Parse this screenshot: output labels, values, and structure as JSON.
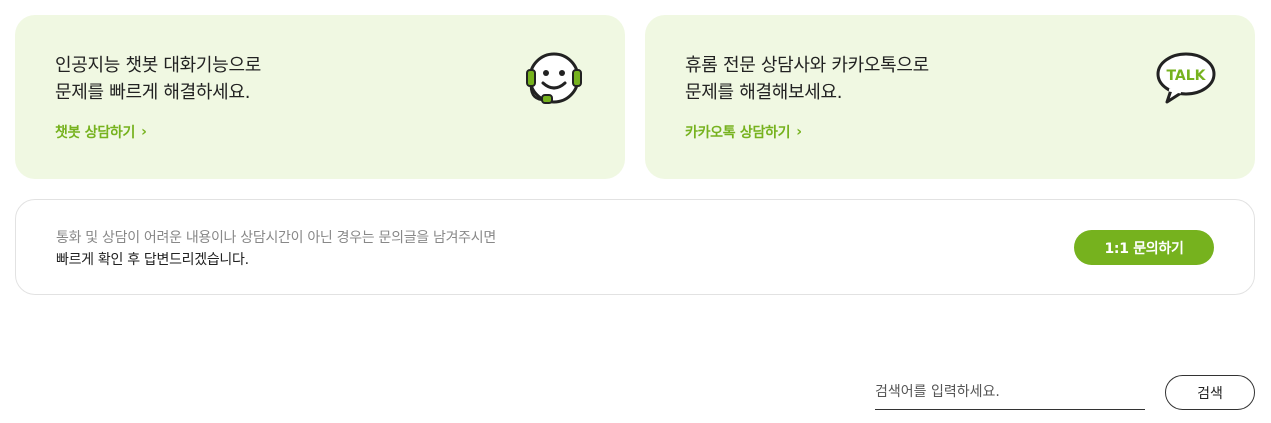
{
  "colors": {
    "accent": "#76b21e",
    "card_bg": "#f0f8e2"
  },
  "chatbot_card": {
    "line1": "인공지능 챗봇 대화기능으로",
    "line2": "문제를 빠르게 해결하세요.",
    "link_label": "챗봇 상담하기",
    "icon": "chatbot-headset-icon"
  },
  "kakao_card": {
    "line1": "휴롬 전문 상담사와 카카오톡으로",
    "line2": "문제를 해결해보세요.",
    "link_label": "카카오톡 상담하기",
    "icon": "kakaotalk-icon",
    "icon_text": "TALK"
  },
  "inquiry": {
    "line1": "통화 및 상담이 어려운 내용이나 상담시간이 아닌 경우는 문의글을 남겨주시면",
    "line2": "빠르게 확인 후 답변드리겠습니다.",
    "button_label": "1:1 문의하기"
  },
  "search": {
    "placeholder": "검색어를 입력하세요.",
    "value": "",
    "button_label": "검색"
  }
}
